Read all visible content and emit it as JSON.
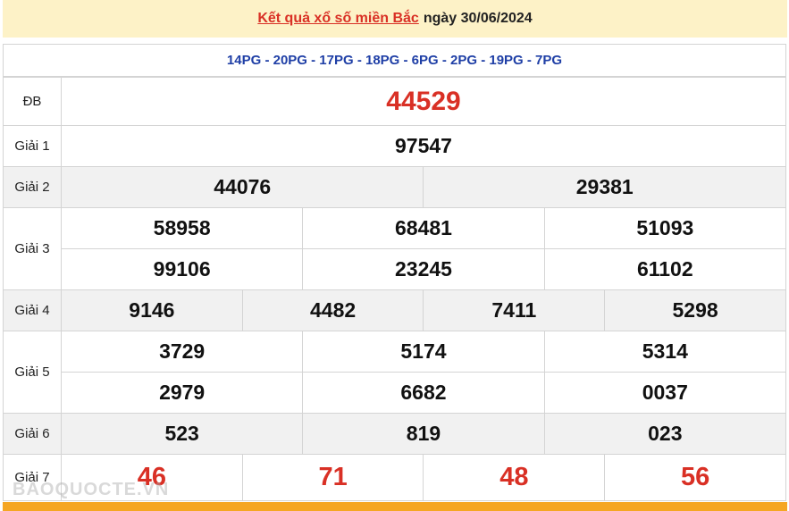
{
  "header": {
    "link_text": "Kết quả xổ số miền Bắc",
    "date_text": "ngày 30/06/2024"
  },
  "codes": "14PG - 20PG - 17PG - 18PG - 6PG - 2PG - 19PG - 7PG",
  "prizes": {
    "db": {
      "label": "ĐB",
      "values": [
        "44529"
      ]
    },
    "g1": {
      "label": "Giải 1",
      "values": [
        "97547"
      ]
    },
    "g2": {
      "label": "Giải 2",
      "values": [
        "44076",
        "29381"
      ]
    },
    "g3": {
      "label": "Giải 3",
      "values": [
        "58958",
        "68481",
        "51093",
        "99106",
        "23245",
        "61102"
      ]
    },
    "g4": {
      "label": "Giải 4",
      "values": [
        "9146",
        "4482",
        "7411",
        "5298"
      ]
    },
    "g5": {
      "label": "Giải 5",
      "values": [
        "3729",
        "5174",
        "5314",
        "2979",
        "6682",
        "0037"
      ]
    },
    "g6": {
      "label": "Giải 6",
      "values": [
        "523",
        "819",
        "023"
      ]
    },
    "g7": {
      "label": "Giải 7",
      "values": [
        "46",
        "71",
        "48",
        "56"
      ]
    }
  },
  "colors": {
    "header_bg": "#fdf2c7",
    "accent_red": "#d93025",
    "code_blue": "#1f3fa6",
    "footer": "#f5a623"
  },
  "watermark": "BAOQUOCTE.VN"
}
